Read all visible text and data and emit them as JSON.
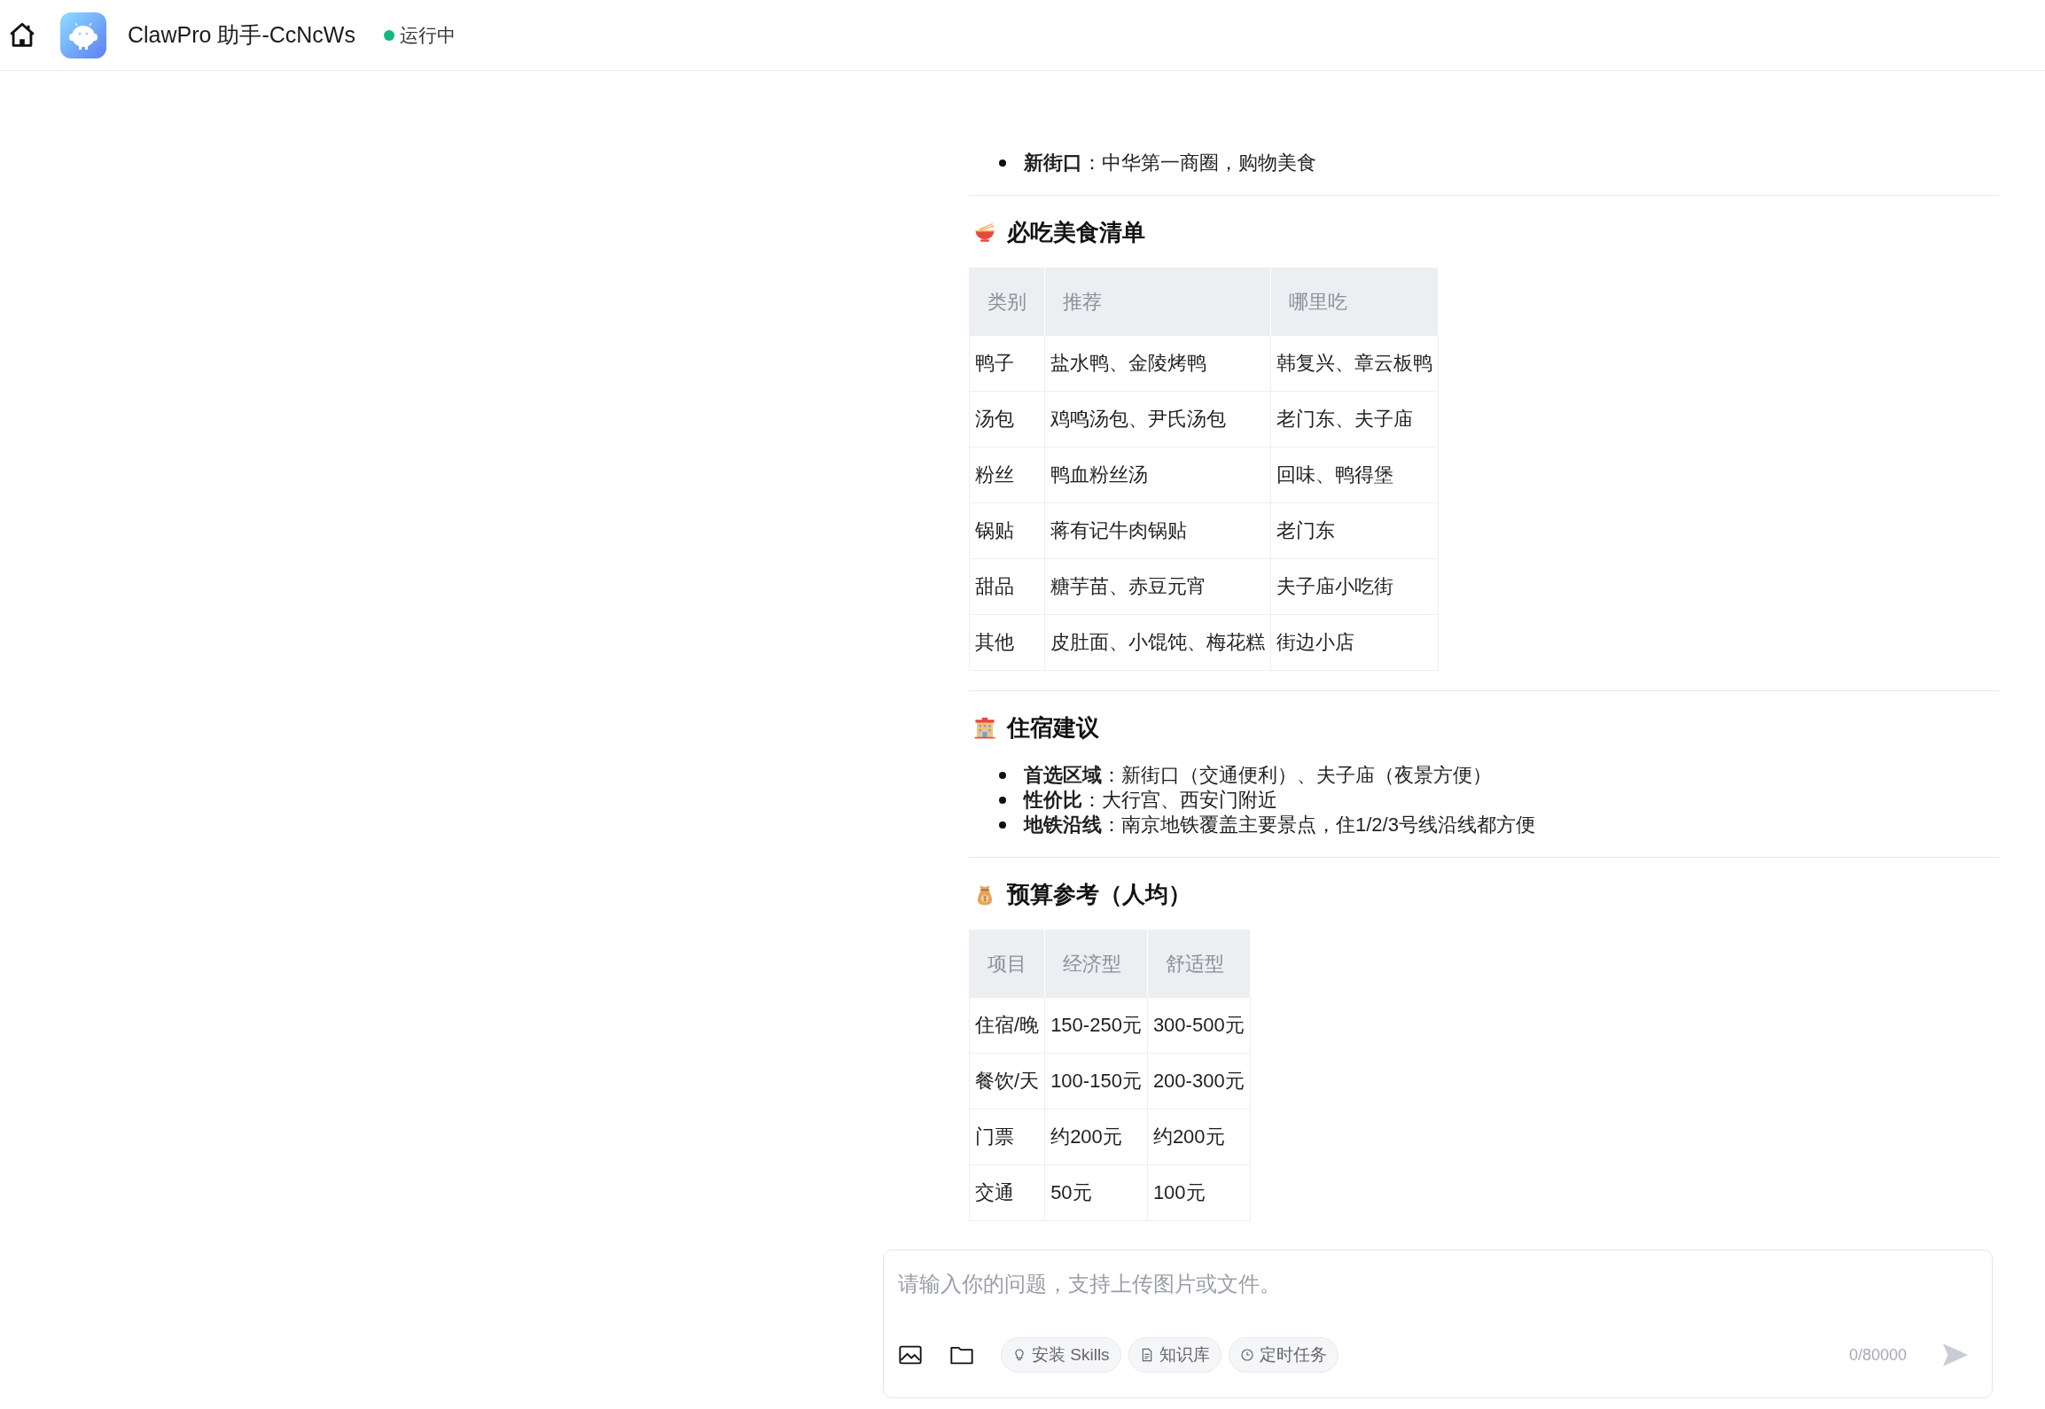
{
  "header": {
    "title": "ClawPro 助手-CcNcWs",
    "status": "运行中"
  },
  "sections": [
    {
      "kind": "list",
      "items": [
        "**新街口**：中华第一商圈，购物美食"
      ]
    },
    {
      "kind": "table",
      "heading": "必吃美食清单",
      "columns": [
        "类别",
        "推荐",
        "哪里吃"
      ],
      "rows": [
        [
          "鸭子",
          "盐水鸭、金陵烤鸭",
          "韩复兴、章云板鸭"
        ],
        [
          "汤包",
          "鸡鸣汤包、尹氏汤包",
          "老门东、夫子庙"
        ],
        [
          "粉丝",
          "鸭血粉丝汤",
          "回味、鸭得堡"
        ],
        [
          "锅贴",
          "蒋有记牛肉锅贴",
          "老门东"
        ],
        [
          "甜品",
          "糖芋苗、赤豆元宵",
          "夫子庙小吃街"
        ],
        [
          "其他",
          "皮肚面、小馄饨、梅花糕",
          "街边小店"
        ]
      ]
    },
    {
      "kind": "list",
      "heading": "住宿建议",
      "items": [
        "**首选区域**：新街口（交通便利）、夫子庙（夜景方便）",
        "**性价比**：大行宫、西安门附近",
        "**地铁沿线**：南京地铁覆盖主要景点，住1/2/3号线沿线都方便"
      ]
    },
    {
      "kind": "table",
      "heading": "预算参考（人均）",
      "columns": [
        "项目",
        "经济型",
        "舒适型"
      ],
      "rows": [
        [
          "住宿/晚",
          "150-250元",
          "300-500元"
        ],
        [
          "餐饮/天",
          "100-150元",
          "200-300元"
        ],
        [
          "门票",
          "约200元",
          "约200元"
        ],
        [
          "交通",
          "50元",
          "100元"
        ]
      ]
    }
  ],
  "composer": {
    "placeholder": "请输入你的问题，支持上传图片或文件。",
    "tools": [
      "安装 Skills",
      "知识库",
      "定时任务"
    ],
    "counter": "0/80000"
  }
}
